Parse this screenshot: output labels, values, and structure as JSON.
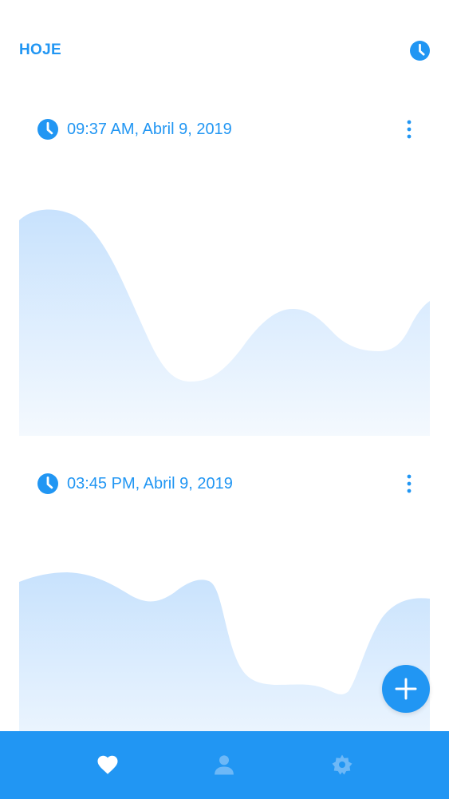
{
  "header": {
    "title": "HOJE",
    "history_icon": "clock-icon"
  },
  "entries": [
    {
      "time": "09:37 AM, Abril 9, 2019",
      "icon": "clock-icon",
      "menu_icon": "more-vertical-icon"
    },
    {
      "time": "03:45 PM, Abril 9, 2019",
      "icon": "clock-icon",
      "menu_icon": "more-vertical-icon"
    }
  ],
  "fab": {
    "icon": "plus-icon"
  },
  "bottom_nav": {
    "items": [
      {
        "icon": "heart-icon",
        "active": true
      },
      {
        "icon": "person-icon",
        "active": false
      },
      {
        "icon": "settings-icon",
        "active": false
      }
    ]
  },
  "colors": {
    "accent": "#2196f3",
    "wave_top": "#cce5fd",
    "wave_bottom": "#f2f8fe",
    "nav_inactive": "#6db8f7"
  }
}
